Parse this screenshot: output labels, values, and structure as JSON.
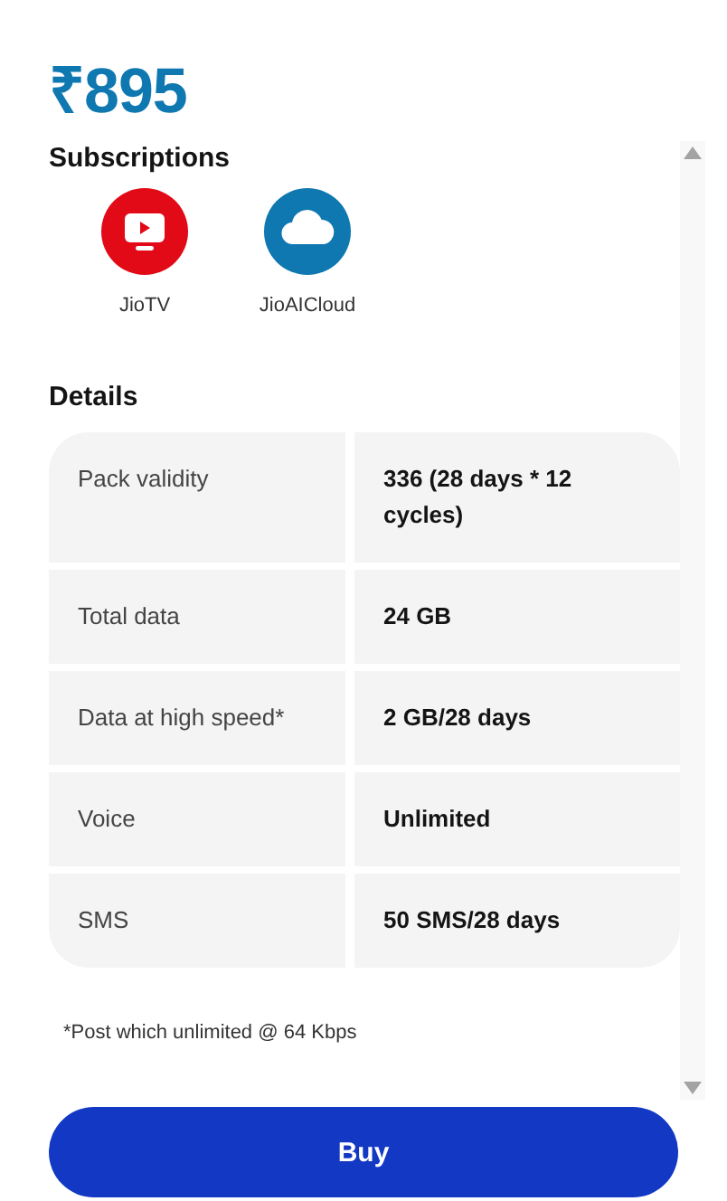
{
  "price": "₹895",
  "subscriptions": {
    "title": "Subscriptions",
    "items": [
      {
        "name": "JioTV",
        "kind": "tv",
        "color": "#e10a16"
      },
      {
        "name": "JioAICloud",
        "kind": "cloud",
        "color": "#0f78b0"
      }
    ]
  },
  "details": {
    "title": "Details",
    "rows": [
      {
        "label": "Pack validity",
        "value": "336 (28 days * 12 cycles)"
      },
      {
        "label": "Total data",
        "value": "24 GB"
      },
      {
        "label": "Data at high speed*",
        "value": "2 GB/28 days"
      },
      {
        "label": "Voice",
        "value": "Unlimited"
      },
      {
        "label": "SMS",
        "value": "50 SMS/28 days"
      }
    ]
  },
  "footnote": "*Post which unlimited @ 64 Kbps",
  "buy_button": "Buy"
}
